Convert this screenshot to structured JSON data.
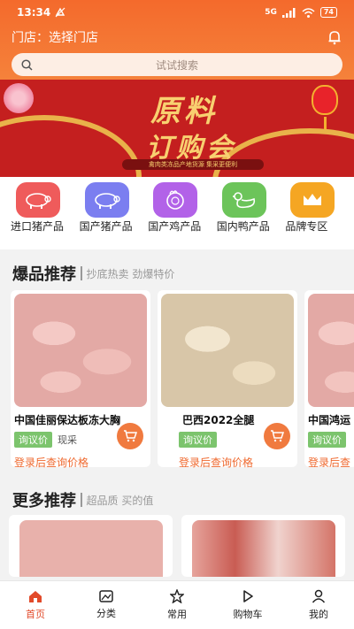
{
  "status": {
    "time": "13:34",
    "network": "5G",
    "battery": "74"
  },
  "header": {
    "store_label": "门店：选择门店",
    "search_placeholder": "试试搜索"
  },
  "banner": {
    "title_line1": "原料",
    "title_line2": "订购会",
    "subtitle": "禽肉类冻品产地货源  集采更便利"
  },
  "categories": [
    {
      "label": "进口猪产品",
      "icon": "pig-icon",
      "color": "#ef5b5b"
    },
    {
      "label": "国产猪产品",
      "icon": "pig-icon",
      "color": "#7b7ef0"
    },
    {
      "label": "国产鸡产品",
      "icon": "chicken-icon",
      "color": "#b262e8"
    },
    {
      "label": "国内鸭产品",
      "icon": "duck-icon",
      "color": "#6cc45a"
    },
    {
      "label": "品牌专区",
      "icon": "crown-icon",
      "color": "#f5a623"
    }
  ],
  "hot_section": {
    "title": "爆品推荐",
    "subtitle": "抄底热卖 劲爆特价"
  },
  "products": [
    {
      "name": "中国佳丽保达板冻大胸",
      "tag": "询议价",
      "tag2": "现采",
      "login": "登录后查询价格"
    },
    {
      "name": "巴西2022全腿",
      "tag": "询议价",
      "tag2": "",
      "login": "登录后查询价格"
    },
    {
      "name": "中国鸿运",
      "tag": "询议价",
      "tag2": "",
      "login": "登录后查"
    }
  ],
  "more_section": {
    "title": "更多推荐",
    "subtitle": "超品质 买的值"
  },
  "tabs": [
    {
      "label": "首页",
      "icon": "home-icon"
    },
    {
      "label": "分类",
      "icon": "category-icon"
    },
    {
      "label": "常用",
      "icon": "star-icon"
    },
    {
      "label": "购物车",
      "icon": "cart-icon"
    },
    {
      "label": "我的",
      "icon": "user-icon"
    }
  ],
  "colors": {
    "accent": "#f46a2c",
    "active_tab": "#e24a2a",
    "tag_green": "#7cc46d"
  }
}
